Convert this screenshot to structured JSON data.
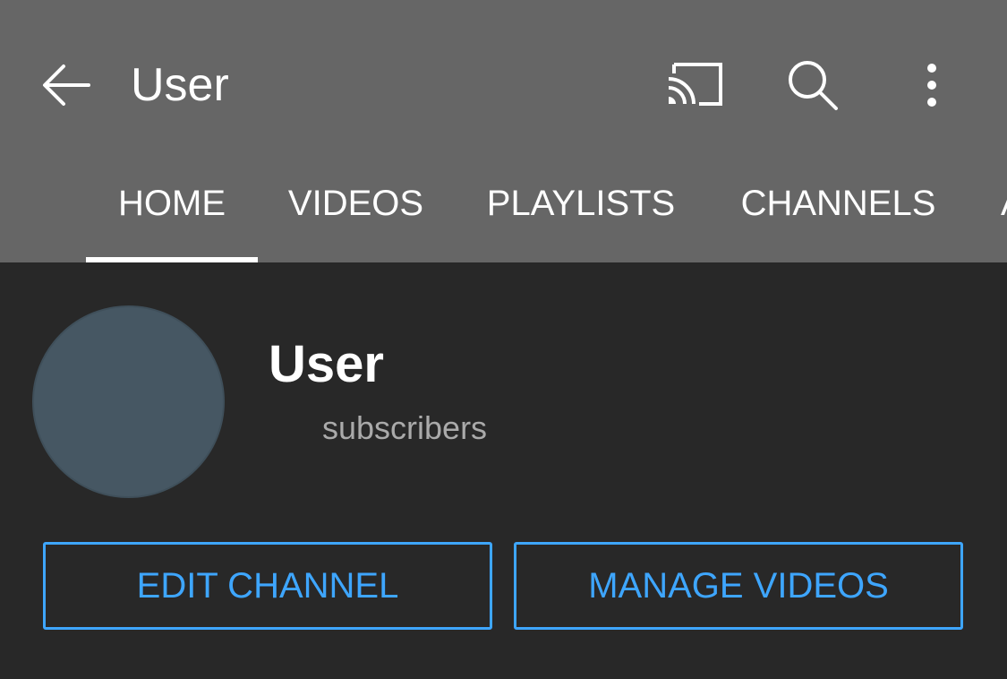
{
  "colors": {
    "toolbar_bg": "#666666",
    "page_bg": "#282828",
    "accent": "#3ea6ff",
    "avatar": "#465763",
    "secondary_text": "#aaaaaa"
  },
  "toolbar": {
    "title": "User",
    "icons": [
      "back-arrow-icon",
      "cast-icon",
      "search-icon",
      "more-vert-icon"
    ]
  },
  "tabs": [
    {
      "label": "HOME",
      "selected": true
    },
    {
      "label": "VIDEOS",
      "selected": false
    },
    {
      "label": "PLAYLISTS",
      "selected": false
    },
    {
      "label": "CHANNELS",
      "selected": false
    },
    {
      "label": "A",
      "selected": false
    }
  ],
  "channel": {
    "name": "User",
    "subscribers": "subscribers"
  },
  "actions": {
    "edit_channel": "EDIT CHANNEL",
    "manage_videos": "MANAGE VIDEOS"
  }
}
